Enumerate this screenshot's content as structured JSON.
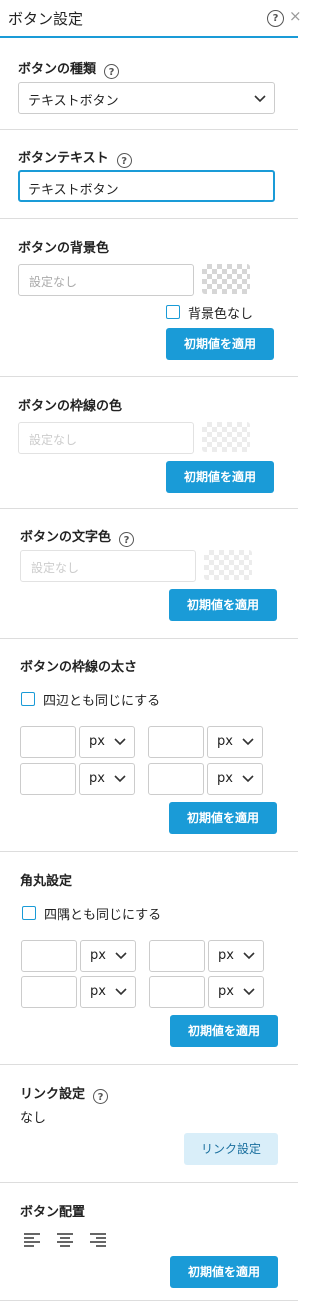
{
  "header": {
    "title": "ボタン設定",
    "help_icon": "question-circle-icon",
    "close_glyph": "×"
  },
  "accent_color": "#1a9bd7",
  "type": {
    "label": "ボタンの種類",
    "value": "テキストボタン"
  },
  "text": {
    "label": "ボタンテキスト",
    "value": "テキストボタン"
  },
  "bg": {
    "label": "ボタンの背景色",
    "placeholder": "設定なし",
    "none_label": "背景色なし",
    "apply": "初期値を適用"
  },
  "border_color": {
    "label": "ボタンの枠線の色",
    "placeholder": "設定なし",
    "apply": "初期値を適用"
  },
  "text_color": {
    "label": "ボタンの文字色",
    "placeholder": "設定なし",
    "apply": "初期値を適用"
  },
  "border_width": {
    "label": "ボタンの枠線の太さ",
    "same_label": "四辺とも同じにする",
    "unit": "px",
    "apply": "初期値を適用"
  },
  "radius": {
    "label": "角丸設定",
    "same_label": "四隅とも同じにする",
    "unit": "px",
    "apply": "初期値を適用"
  },
  "link": {
    "label": "リンク設定",
    "value": "なし",
    "button": "リンク設定"
  },
  "align": {
    "label": "ボタン配置",
    "options": [
      "align-left-icon",
      "align-center-icon",
      "align-right-icon"
    ],
    "apply": "初期値を適用"
  }
}
